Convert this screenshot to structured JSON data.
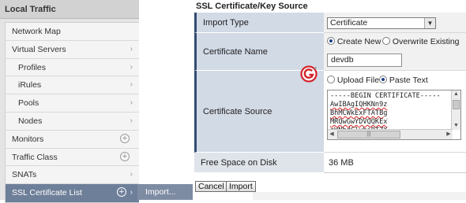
{
  "sidebar": {
    "header": "Local Traffic",
    "items": [
      {
        "label": "Network Map",
        "kind": "none",
        "sub": false
      },
      {
        "label": "Virtual Servers",
        "kind": "chevron",
        "sub": false
      },
      {
        "label": "Profiles",
        "kind": "chevron",
        "sub": true
      },
      {
        "label": "iRules",
        "kind": "chevron",
        "sub": true
      },
      {
        "label": "Pools",
        "kind": "chevron",
        "sub": true
      },
      {
        "label": "Nodes",
        "kind": "chevron",
        "sub": true
      },
      {
        "label": "Monitors",
        "kind": "plus",
        "sub": false
      },
      {
        "label": "Traffic Class",
        "kind": "plus",
        "sub": false
      },
      {
        "label": "SNATs",
        "kind": "chevron",
        "sub": false
      },
      {
        "label": "SSL Certificate List",
        "kind": "plus-chevron",
        "sub": false,
        "active": true
      }
    ],
    "flyout": "Import..."
  },
  "form": {
    "title": "SSL Certificate/Key Source",
    "import_type": {
      "label": "Import Type",
      "value": "Certificate"
    },
    "certificate_name": {
      "label": "Certificate Name",
      "option_create": "Create New",
      "option_overwrite": "Overwrite Existing",
      "value": "devdb"
    },
    "certificate_source": {
      "label": "Certificate Source",
      "option_upload": "Upload File",
      "option_paste": "Paste Text",
      "lines": [
        "-----BEGIN CERTIFICATE-----",
        "AwIBAgIQHKNn9z",
        "BhMCWkExFTATBg",
        "MRQwGwYDVQQKEx",
        "aWNhdGlvbiBTZX"
      ]
    },
    "disk": {
      "label": "Free Space on Disk",
      "value": "36 MB"
    },
    "buttons": {
      "cancel": "Cancel",
      "import": "Import"
    }
  },
  "colors": {
    "label_bg": "#d2dae6",
    "label_accent": "#344b72",
    "active_item": "#6e7f99",
    "logo_red": "#d6232a"
  },
  "icons": [
    "chevron-right-icon",
    "plus-circle-icon",
    "dropdown-arrow-icon",
    "g-logo-icon"
  ]
}
